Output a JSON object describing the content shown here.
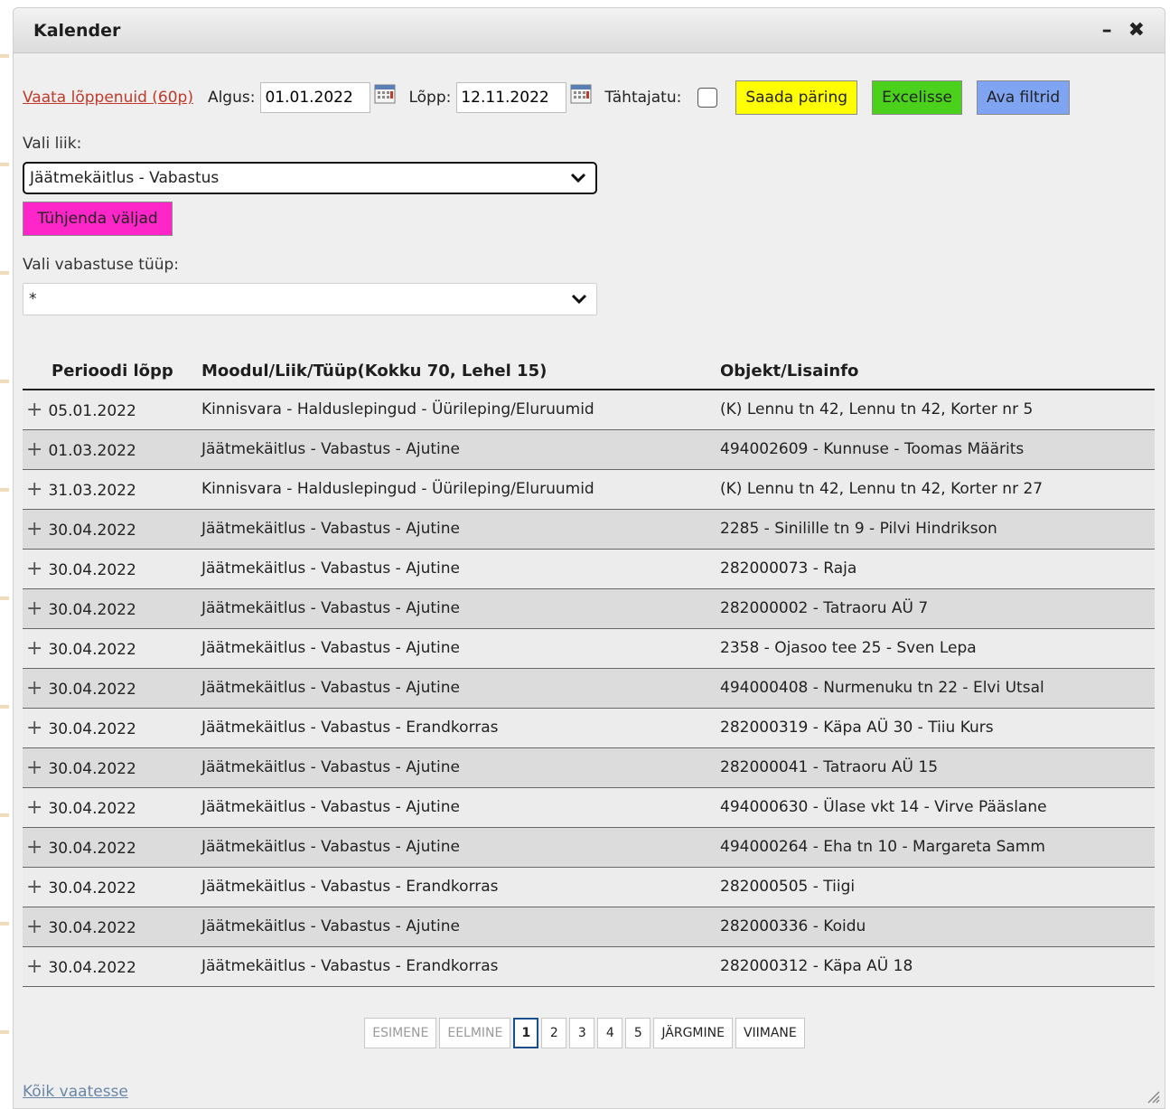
{
  "window": {
    "title": "Kalender"
  },
  "toolbar": {
    "expired_link": "Vaata lõppenuid (60p)",
    "start_label": "Algus:",
    "start_value": "01.01.2022",
    "end_label": "Lõpp:",
    "end_value": "12.11.2022",
    "no_deadline_label": "Tähtajatu:",
    "send_button": "Saada päring",
    "excel_button": "Excelisse",
    "filters_button": "Ava filtrid"
  },
  "filters": {
    "kind_label": "Vali liik:",
    "kind_value": "Jäätmekäitlus - Vabastus",
    "clear_button": "Tühjenda väljad",
    "type_label": "Vali vabastuse tüüp:",
    "type_value": "*"
  },
  "table": {
    "headers": [
      "Perioodi lõpp",
      "Moodul/Liik/Tüüp(Kokku 70, Lehel 15)",
      "Objekt/Lisainfo"
    ],
    "rows": [
      [
        "05.01.2022",
        "Kinnisvara - Halduslepingud - Üürileping/Eluruumid",
        "(K) Lennu tn 42, Lennu tn 42, Korter nr 5"
      ],
      [
        "01.03.2022",
        "Jäätmekäitlus - Vabastus - Ajutine",
        "494002609 - Kunnuse - Toomas Määrits"
      ],
      [
        "31.03.2022",
        "Kinnisvara - Halduslepingud - Üürileping/Eluruumid",
        "(K) Lennu tn 42, Lennu tn 42, Korter nr 27"
      ],
      [
        "30.04.2022",
        "Jäätmekäitlus - Vabastus - Ajutine",
        "2285 - Sinilille tn 9 - Pilvi Hindrikson"
      ],
      [
        "30.04.2022",
        "Jäätmekäitlus - Vabastus - Ajutine",
        "282000073 - Raja"
      ],
      [
        "30.04.2022",
        "Jäätmekäitlus - Vabastus - Ajutine",
        "282000002 - Tatraoru AÜ 7"
      ],
      [
        "30.04.2022",
        "Jäätmekäitlus - Vabastus - Ajutine",
        "2358 - Ojasoo tee 25 - Sven Lepa"
      ],
      [
        "30.04.2022",
        "Jäätmekäitlus - Vabastus - Ajutine",
        "494000408 - Nurmenuku tn 22 - Elvi Utsal"
      ],
      [
        "30.04.2022",
        "Jäätmekäitlus - Vabastus - Erandkorras",
        "282000319 - Käpa AÜ 30 - Tiiu Kurs"
      ],
      [
        "30.04.2022",
        "Jäätmekäitlus - Vabastus - Ajutine",
        "282000041 - Tatraoru AÜ 15"
      ],
      [
        "30.04.2022",
        "Jäätmekäitlus - Vabastus - Ajutine",
        "494000630 - Ülase vkt 14 - Virve Pääslane"
      ],
      [
        "30.04.2022",
        "Jäätmekäitlus - Vabastus - Ajutine",
        "494000264 - Eha tn 10 - Margareta Samm"
      ],
      [
        "30.04.2022",
        "Jäätmekäitlus - Vabastus - Erandkorras",
        "282000505 - Tiigi"
      ],
      [
        "30.04.2022",
        "Jäätmekäitlus - Vabastus - Ajutine",
        "282000336 - Koidu"
      ],
      [
        "30.04.2022",
        "Jäätmekäitlus - Vabastus - Erandkorras",
        "282000312 - Käpa AÜ 18"
      ]
    ]
  },
  "pager": {
    "first": "ESIMENE",
    "prev": "EELMINE",
    "pages": [
      "1",
      "2",
      "3",
      "4",
      "5"
    ],
    "current_page": "1",
    "next": "JÄRGMINE",
    "last": "VIIMANE"
  },
  "footer": {
    "all_link": "Kõik vaatesse"
  }
}
